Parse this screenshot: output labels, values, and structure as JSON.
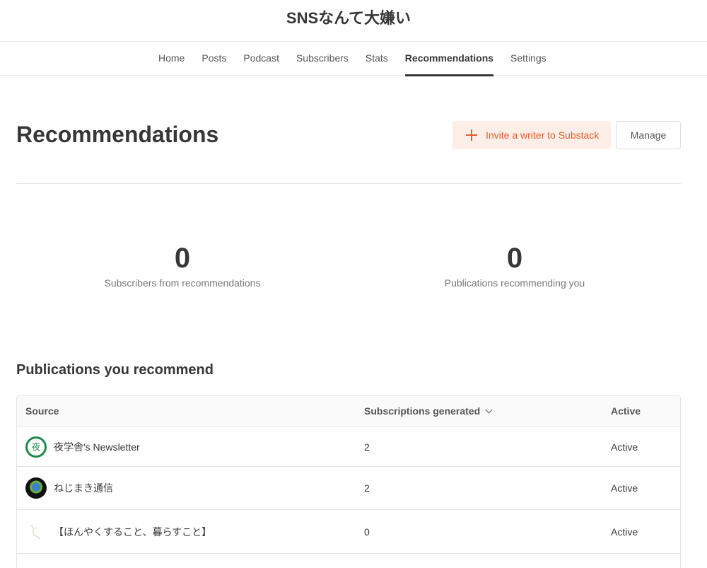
{
  "publication": {
    "title": "SNSなんて大嫌い"
  },
  "nav": {
    "tabs": [
      {
        "label": "Home"
      },
      {
        "label": "Posts"
      },
      {
        "label": "Podcast"
      },
      {
        "label": "Subscribers"
      },
      {
        "label": "Stats"
      },
      {
        "label": "Recommendations",
        "active": true
      },
      {
        "label": "Settings"
      }
    ]
  },
  "page": {
    "title": "Recommendations",
    "invite_label": "Invite a writer to Substack",
    "manage_label": "Manage"
  },
  "stats": [
    {
      "value": "0",
      "label": "Subscribers from recommendations"
    },
    {
      "value": "0",
      "label": "Publications recommending you"
    }
  ],
  "table": {
    "title": "Publications you recommend",
    "headers": {
      "source": "Source",
      "subs": "Subscriptions generated",
      "active": "Active"
    },
    "rows": [
      {
        "avatar_text": "夜",
        "source": "夜学舎's Newsletter",
        "subs": "2",
        "active": "Active"
      },
      {
        "avatar_text": "",
        "source": "ねじまき通信",
        "subs": "2",
        "active": "Active"
      },
      {
        "avatar_text": "",
        "source": "【ほんやくすること、暮らすこと】",
        "subs": "0",
        "active": "Active"
      }
    ]
  },
  "colors": {
    "accent": "#e05f2d",
    "accent_bg": "#fdeee7",
    "text": "#363737",
    "border": "#e5e5e5"
  }
}
